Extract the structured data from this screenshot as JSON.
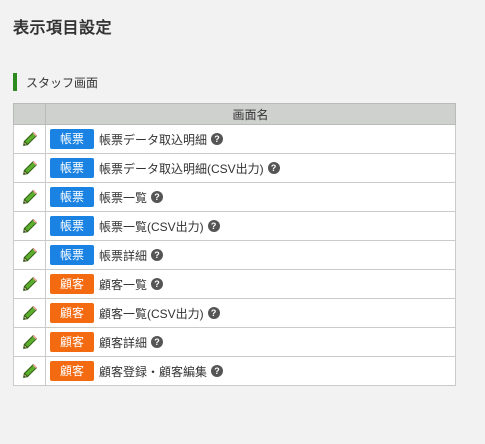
{
  "page": {
    "title": "表示項目設定"
  },
  "section": {
    "label": "スタッフ画面"
  },
  "table": {
    "header_edit": "",
    "header_name": "画面名"
  },
  "colors": {
    "section_bar": "#2e8b1f",
    "tag_chohyo": "#1a82e2",
    "tag_kokyaku": "#f36a10",
    "header_bg": "#cfd1cf",
    "page_bg": "#f1f2f1"
  },
  "icons": {
    "edit": "pencil-icon",
    "help": "help-icon"
  },
  "help_glyph": "?",
  "rows": [
    {
      "tag": "帳票",
      "tag_color": "tag_chohyo",
      "name": "帳票データ取込明細"
    },
    {
      "tag": "帳票",
      "tag_color": "tag_chohyo",
      "name": "帳票データ取込明細(CSV出力)"
    },
    {
      "tag": "帳票",
      "tag_color": "tag_chohyo",
      "name": "帳票一覧"
    },
    {
      "tag": "帳票",
      "tag_color": "tag_chohyo",
      "name": "帳票一覧(CSV出力)"
    },
    {
      "tag": "帳票",
      "tag_color": "tag_chohyo",
      "name": "帳票詳細"
    },
    {
      "tag": "顧客",
      "tag_color": "tag_kokyaku",
      "name": "顧客一覧"
    },
    {
      "tag": "顧客",
      "tag_color": "tag_kokyaku",
      "name": "顧客一覧(CSV出力)"
    },
    {
      "tag": "顧客",
      "tag_color": "tag_kokyaku",
      "name": "顧客詳細"
    },
    {
      "tag": "顧客",
      "tag_color": "tag_kokyaku",
      "name": "顧客登録・顧客編集"
    }
  ]
}
